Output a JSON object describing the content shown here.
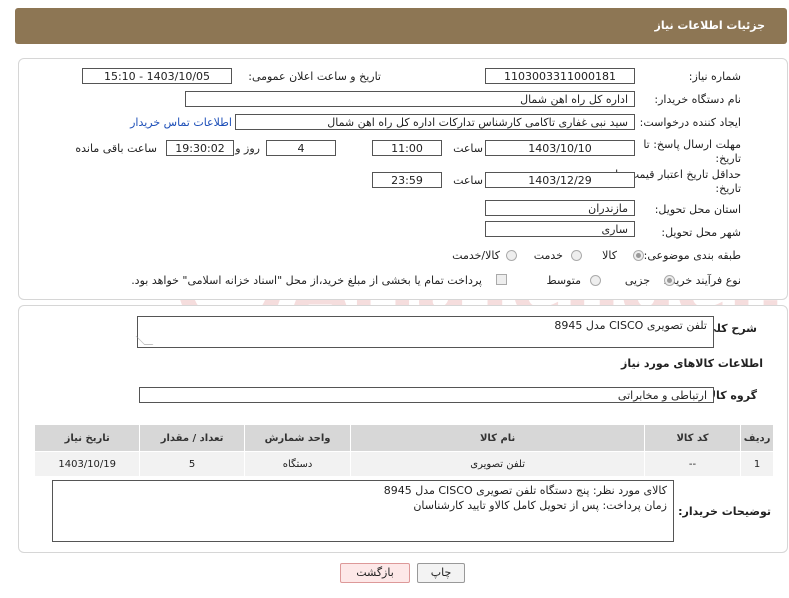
{
  "header": {
    "title": "جزئیات اطلاعات نیاز"
  },
  "form": {
    "need_number_label": "شماره نیاز:",
    "need_number": "1103003311000181",
    "announce_label": "تاریخ و ساعت اعلان عمومی:",
    "announce_value": "1403/10/05 - 15:10",
    "buyer_org_label": "نام دستگاه خریدار:",
    "buyer_org": "اداره کل راه اهن شمال",
    "creator_label": "ایجاد کننده درخواست:",
    "creator": "سید نبی غفاری تاکامی کارشناس تدارکات اداره کل راه اهن شمال",
    "contact_link": "اطلاعات تماس خریدار",
    "deadline_label_1": "مهلت ارسال پاسخ: تا",
    "deadline_label_2": "تاریخ:",
    "deadline_date": "1403/10/10",
    "time_label": "ساعت",
    "deadline_time": "11:00",
    "days_value": "4",
    "days_label": "روز و",
    "remaining_time": "19:30:02",
    "remaining_label": "ساعت باقی مانده",
    "validity_label_1": "حداقل تاریخ اعتبار قیمت: تا",
    "validity_label_2": "تاریخ:",
    "validity_date": "1403/12/29",
    "validity_time": "23:59",
    "province_label": "استان محل تحویل:",
    "province": "مازندران",
    "city_label": "شهر محل تحویل:",
    "city": "ساری",
    "category_label": "طبقه بندی موضوعی:",
    "category_options": [
      "کالا",
      "خدمت",
      "کالا/خدمت"
    ],
    "process_label": "نوع فرآیند خرید :",
    "process_options": [
      "جزیی",
      "متوسط"
    ],
    "payment_note": "پرداخت تمام یا بخشی از مبلغ خرید،از محل \"اسناد خزانه اسلامی\" خواهد بود."
  },
  "details": {
    "description_label": "شرح کلی نیاز:",
    "description": "تلفن تصویری CISCO مدل 8945",
    "goods_info_title": "اطلاعات کالاهای مورد نیاز",
    "goods_group_label": "گروه کالا:",
    "goods_group": "ارتباطی و مخابراتی",
    "table": {
      "headers": [
        "ردیف",
        "کد کالا",
        "نام کالا",
        "واحد شمارش",
        "تعداد / مقدار",
        "تاریخ نیاز"
      ],
      "rows": [
        [
          "1",
          "--",
          "تلفن تصویری",
          "دستگاه",
          "5",
          "1403/10/19"
        ]
      ]
    },
    "buyer_notes_label": "توضیحات خریدار:",
    "buyer_notes_line1": "کالای مورد نظر: پنج دستگاه تلفن تصویری CISCO مدل 8945",
    "buyer_notes_line2": "زمان پرداخت: پس از تحویل کامل کالاو تایید کارشناسان"
  },
  "buttons": {
    "print": "چاپ",
    "back": "بازگشت"
  },
  "watermark": {
    "text": "AriaTender.neT"
  }
}
